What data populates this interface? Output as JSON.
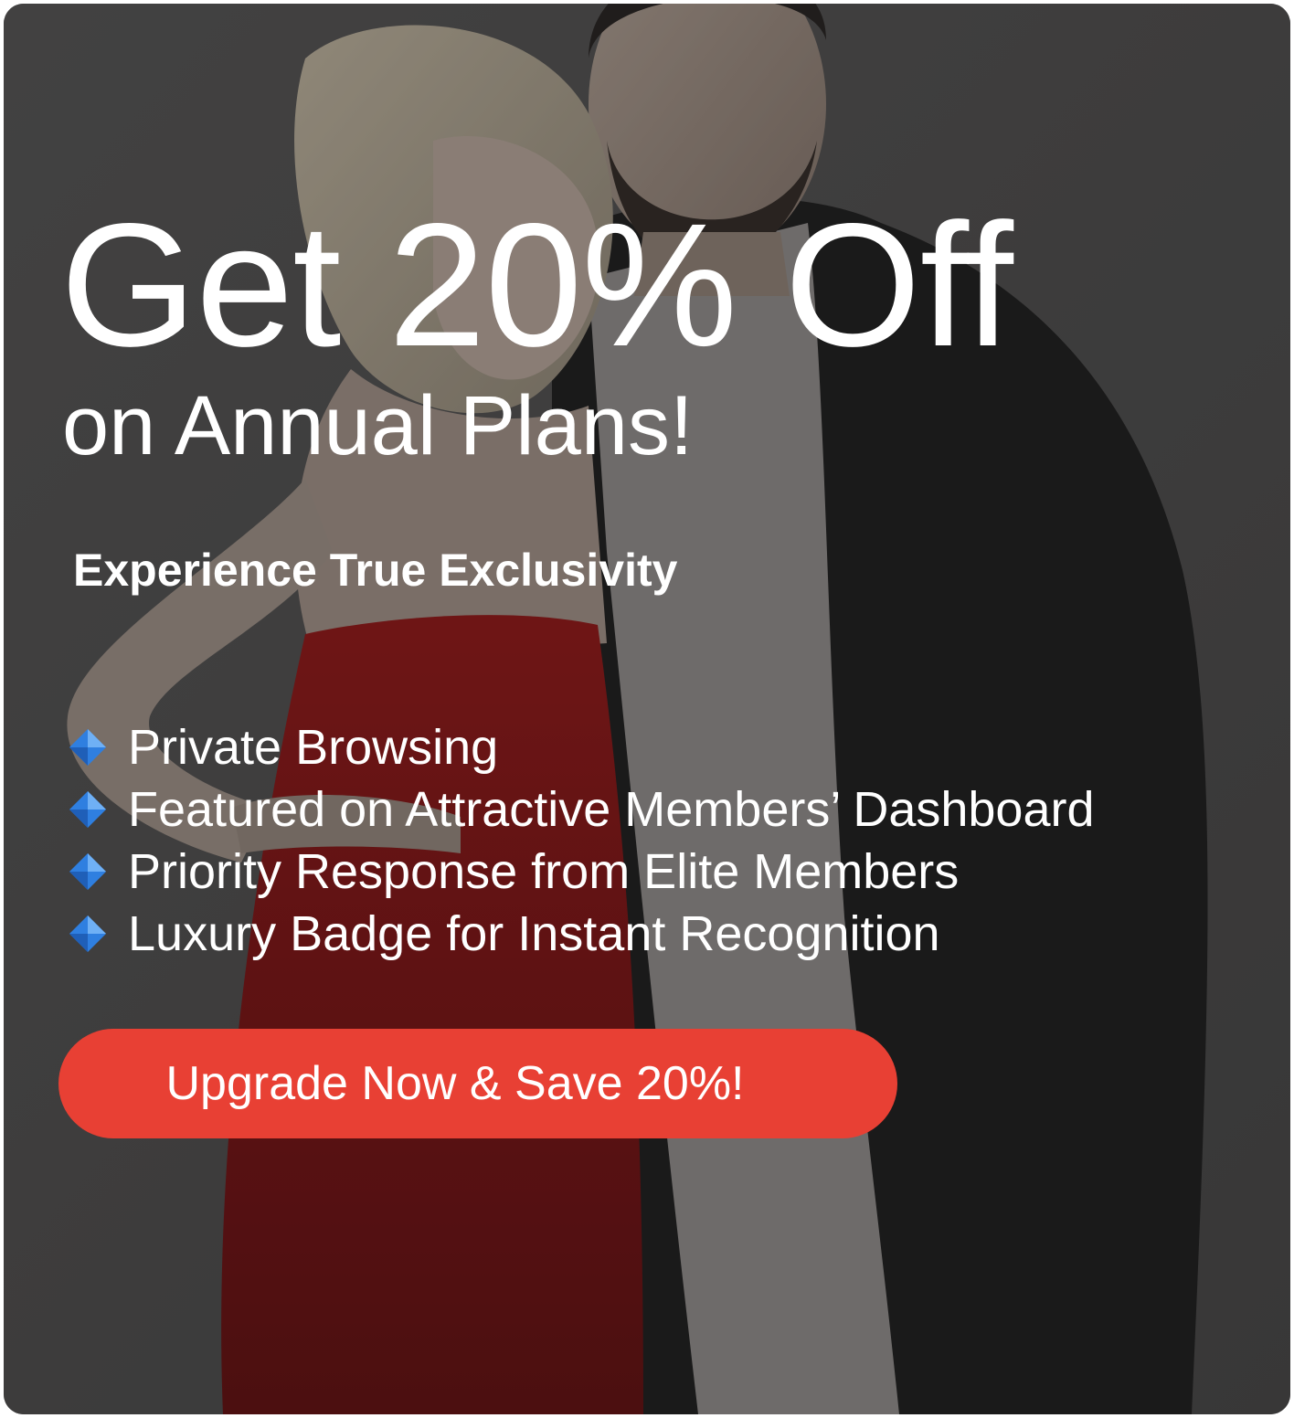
{
  "promo": {
    "headline": "Get 20% Off",
    "subheadline": "on Annual Plans!",
    "tagline": "Experience True Exclusivity",
    "features": [
      {
        "icon": "blue-diamond-icon",
        "label": "Private Browsing"
      },
      {
        "icon": "blue-diamond-icon",
        "label": "Featured on Attractive Members’ Dashboard"
      },
      {
        "icon": "blue-diamond-icon",
        "label": "Priority Response from Elite Members"
      },
      {
        "icon": "blue-diamond-icon",
        "label": "Luxury Badge for Instant Recognition"
      }
    ],
    "cta_label": "Upgrade Now & Save 20%!"
  },
  "colors": {
    "card_background": "#4a4949",
    "cta_background": "#e84034",
    "text": "#ffffff",
    "diamond_icon": "#2f7fe0"
  }
}
